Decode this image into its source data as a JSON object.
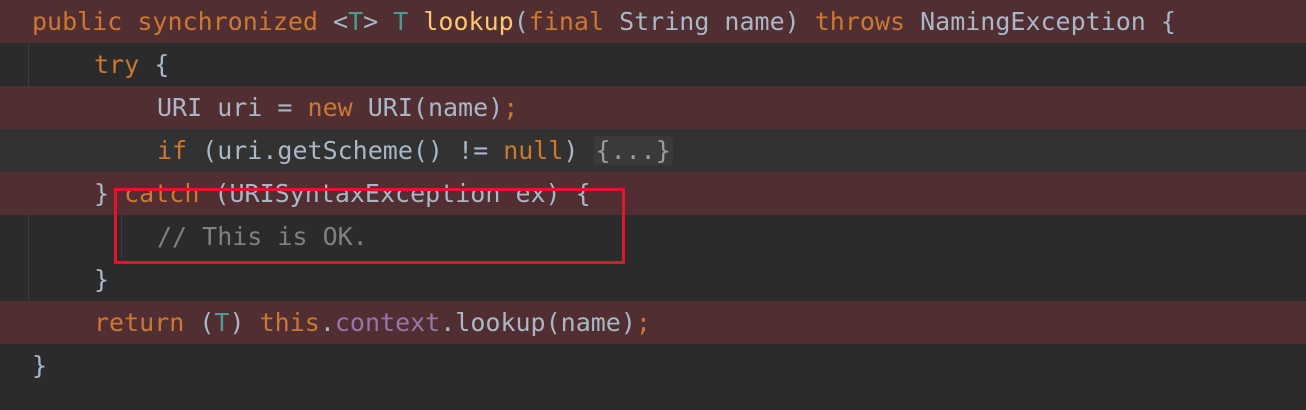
{
  "editor": {
    "lines": [
      {
        "tokens": [
          {
            "t": "public ",
            "c": "kw"
          },
          {
            "t": "synchronized ",
            "c": "kw"
          },
          {
            "t": "<",
            "c": ""
          },
          {
            "t": "T",
            "c": "tp"
          },
          {
            "t": "> ",
            "c": ""
          },
          {
            "t": "T ",
            "c": "tp"
          },
          {
            "t": "lookup",
            "c": "fn"
          },
          {
            "t": "(",
            "c": ""
          },
          {
            "t": "final ",
            "c": "kw"
          },
          {
            "t": "String name) ",
            "c": ""
          },
          {
            "t": "throws ",
            "c": "kw"
          },
          {
            "t": "NamingException {",
            "c": ""
          }
        ]
      },
      {
        "tokens": [
          {
            "t": "try ",
            "c": "kw"
          },
          {
            "t": "{",
            "c": ""
          }
        ]
      },
      {
        "tokens": [
          {
            "t": "URI uri = ",
            "c": ""
          },
          {
            "t": "new ",
            "c": "kw"
          },
          {
            "t": "URI(name)",
            "c": ""
          },
          {
            "t": ";",
            "c": "kw"
          }
        ]
      },
      {
        "tokens": [
          {
            "t": "if ",
            "c": "kw"
          },
          {
            "t": "(uri.getScheme() != ",
            "c": ""
          },
          {
            "t": "null",
            "c": "kw"
          },
          {
            "t": ") ",
            "c": ""
          },
          {
            "t": "{...}",
            "c": "fold"
          }
        ]
      },
      {
        "tokens": [
          {
            "t": "} ",
            "c": ""
          },
          {
            "t": "catch ",
            "c": "kw"
          },
          {
            "t": "(URISyntaxException ex) {",
            "c": ""
          }
        ]
      },
      {
        "tokens": [
          {
            "t": "// This is OK.",
            "c": "cm"
          }
        ]
      },
      {
        "tokens": [
          {
            "t": "}",
            "c": ""
          }
        ]
      },
      {
        "tokens": [
          {
            "t": "return ",
            "c": "kw"
          },
          {
            "t": "(",
            "c": ""
          },
          {
            "t": "T",
            "c": "tp"
          },
          {
            "t": ") ",
            "c": ""
          },
          {
            "t": "this",
            "c": "kw"
          },
          {
            "t": ".",
            "c": ""
          },
          {
            "t": "context",
            "c": "field"
          },
          {
            "t": ".lookup(name)",
            "c": ""
          },
          {
            "t": ";",
            "c": "kw"
          }
        ]
      },
      {
        "tokens": [
          {
            "t": "}",
            "c": ""
          }
        ]
      }
    ]
  }
}
